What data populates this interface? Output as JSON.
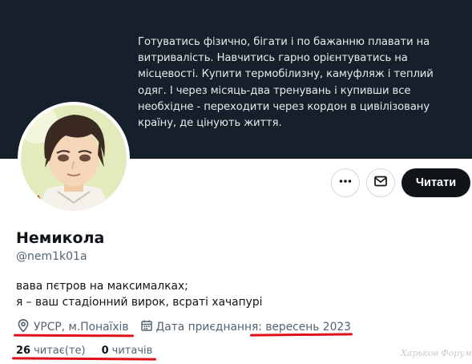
{
  "banner": {
    "text": "Готуватись фізично, бігати і по бажанню плавати на витривалість. Навчитись гарно орієнтуватись на місцевості. Купити термобілизну, камуфляж і теплий одяг. І через місяць-два тренувань і купивши все необхідне - переходити через кордон в цивілізовану країну, де цінують життя."
  },
  "profile": {
    "name": "Немикола",
    "handle": "@nem1k01a",
    "bio_line1": "вава пєтров на максималках;",
    "bio_line2": "я – ваш стадіонний вирок, всраті хачапурі",
    "location": "УРСР, м.Понаїхів",
    "joined": "Дата приєднання: вересень 2023"
  },
  "stats": {
    "following_count": "26",
    "following_label": "читає(те)",
    "followers_count": "0",
    "followers_label": "читачів"
  },
  "actions": {
    "follow_label": "Читати",
    "more_icon": "more-icon",
    "mail_icon": "mail-icon"
  },
  "watermark": "Харьков Форум",
  "colors": {
    "banner_bg": "#15202b",
    "annotation_red": "#e0101a",
    "follow_bg": "#0f1419",
    "secondary_text": "#536471"
  }
}
